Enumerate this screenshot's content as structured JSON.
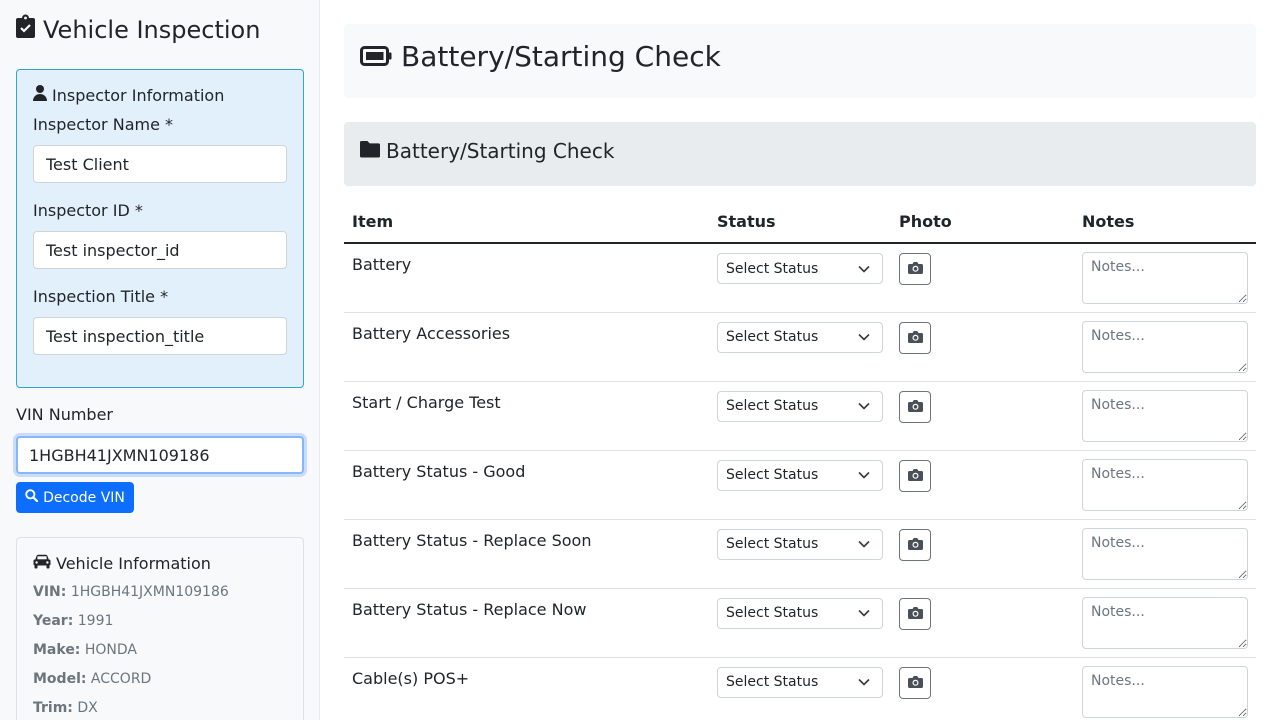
{
  "sidebar": {
    "app_title": "Vehicle Inspection",
    "inspector": {
      "heading": "Inspector Information",
      "name_label": "Inspector Name *",
      "name_value": "Test Client",
      "id_label": "Inspector ID *",
      "id_value": "Test inspector_id",
      "title_label": "Inspection Title *",
      "title_value": "Test inspection_title"
    },
    "vin": {
      "label": "VIN Number",
      "value": "1HGBH41JXMN109186",
      "decode_label": "Decode VIN"
    },
    "vehicle": {
      "heading": "Vehicle Information",
      "vin_key": "VIN:",
      "vin_value": "1HGBH41JXMN109186",
      "year_key": "Year:",
      "year_value": "1991",
      "make_key": "Make:",
      "make_value": "HONDA",
      "model_key": "Model:",
      "model_value": "ACCORD",
      "trim_key": "Trim:",
      "trim_value": "DX"
    }
  },
  "main": {
    "page_title": "Battery/Starting Check",
    "section_title": "Battery/Starting Check",
    "columns": [
      "Item",
      "Status",
      "Photo",
      "Notes"
    ],
    "status_placeholder": "Select Status",
    "notes_placeholder": "Notes...",
    "items": [
      "Battery",
      "Battery Accessories",
      "Start / Charge Test",
      "Battery Status - Good",
      "Battery Status - Replace Soon",
      "Battery Status - Replace Now",
      "Cable(s) POS+"
    ]
  },
  "colors": {
    "primary": "#0d6efd",
    "inspector_card_bg": "#e2f0fc",
    "inspector_card_border": "#2fa4cd",
    "sidebar_bg": "#f8f9fa",
    "section_bg": "#e9ecef"
  },
  "icons": {
    "app_title": "clipboard-check-icon",
    "inspector": "user-icon",
    "decode": "search-icon",
    "vehicle": "car-icon",
    "page_title": "battery-icon",
    "section": "folder-icon",
    "photo": "camera-icon",
    "select": "chevron-down-icon"
  }
}
